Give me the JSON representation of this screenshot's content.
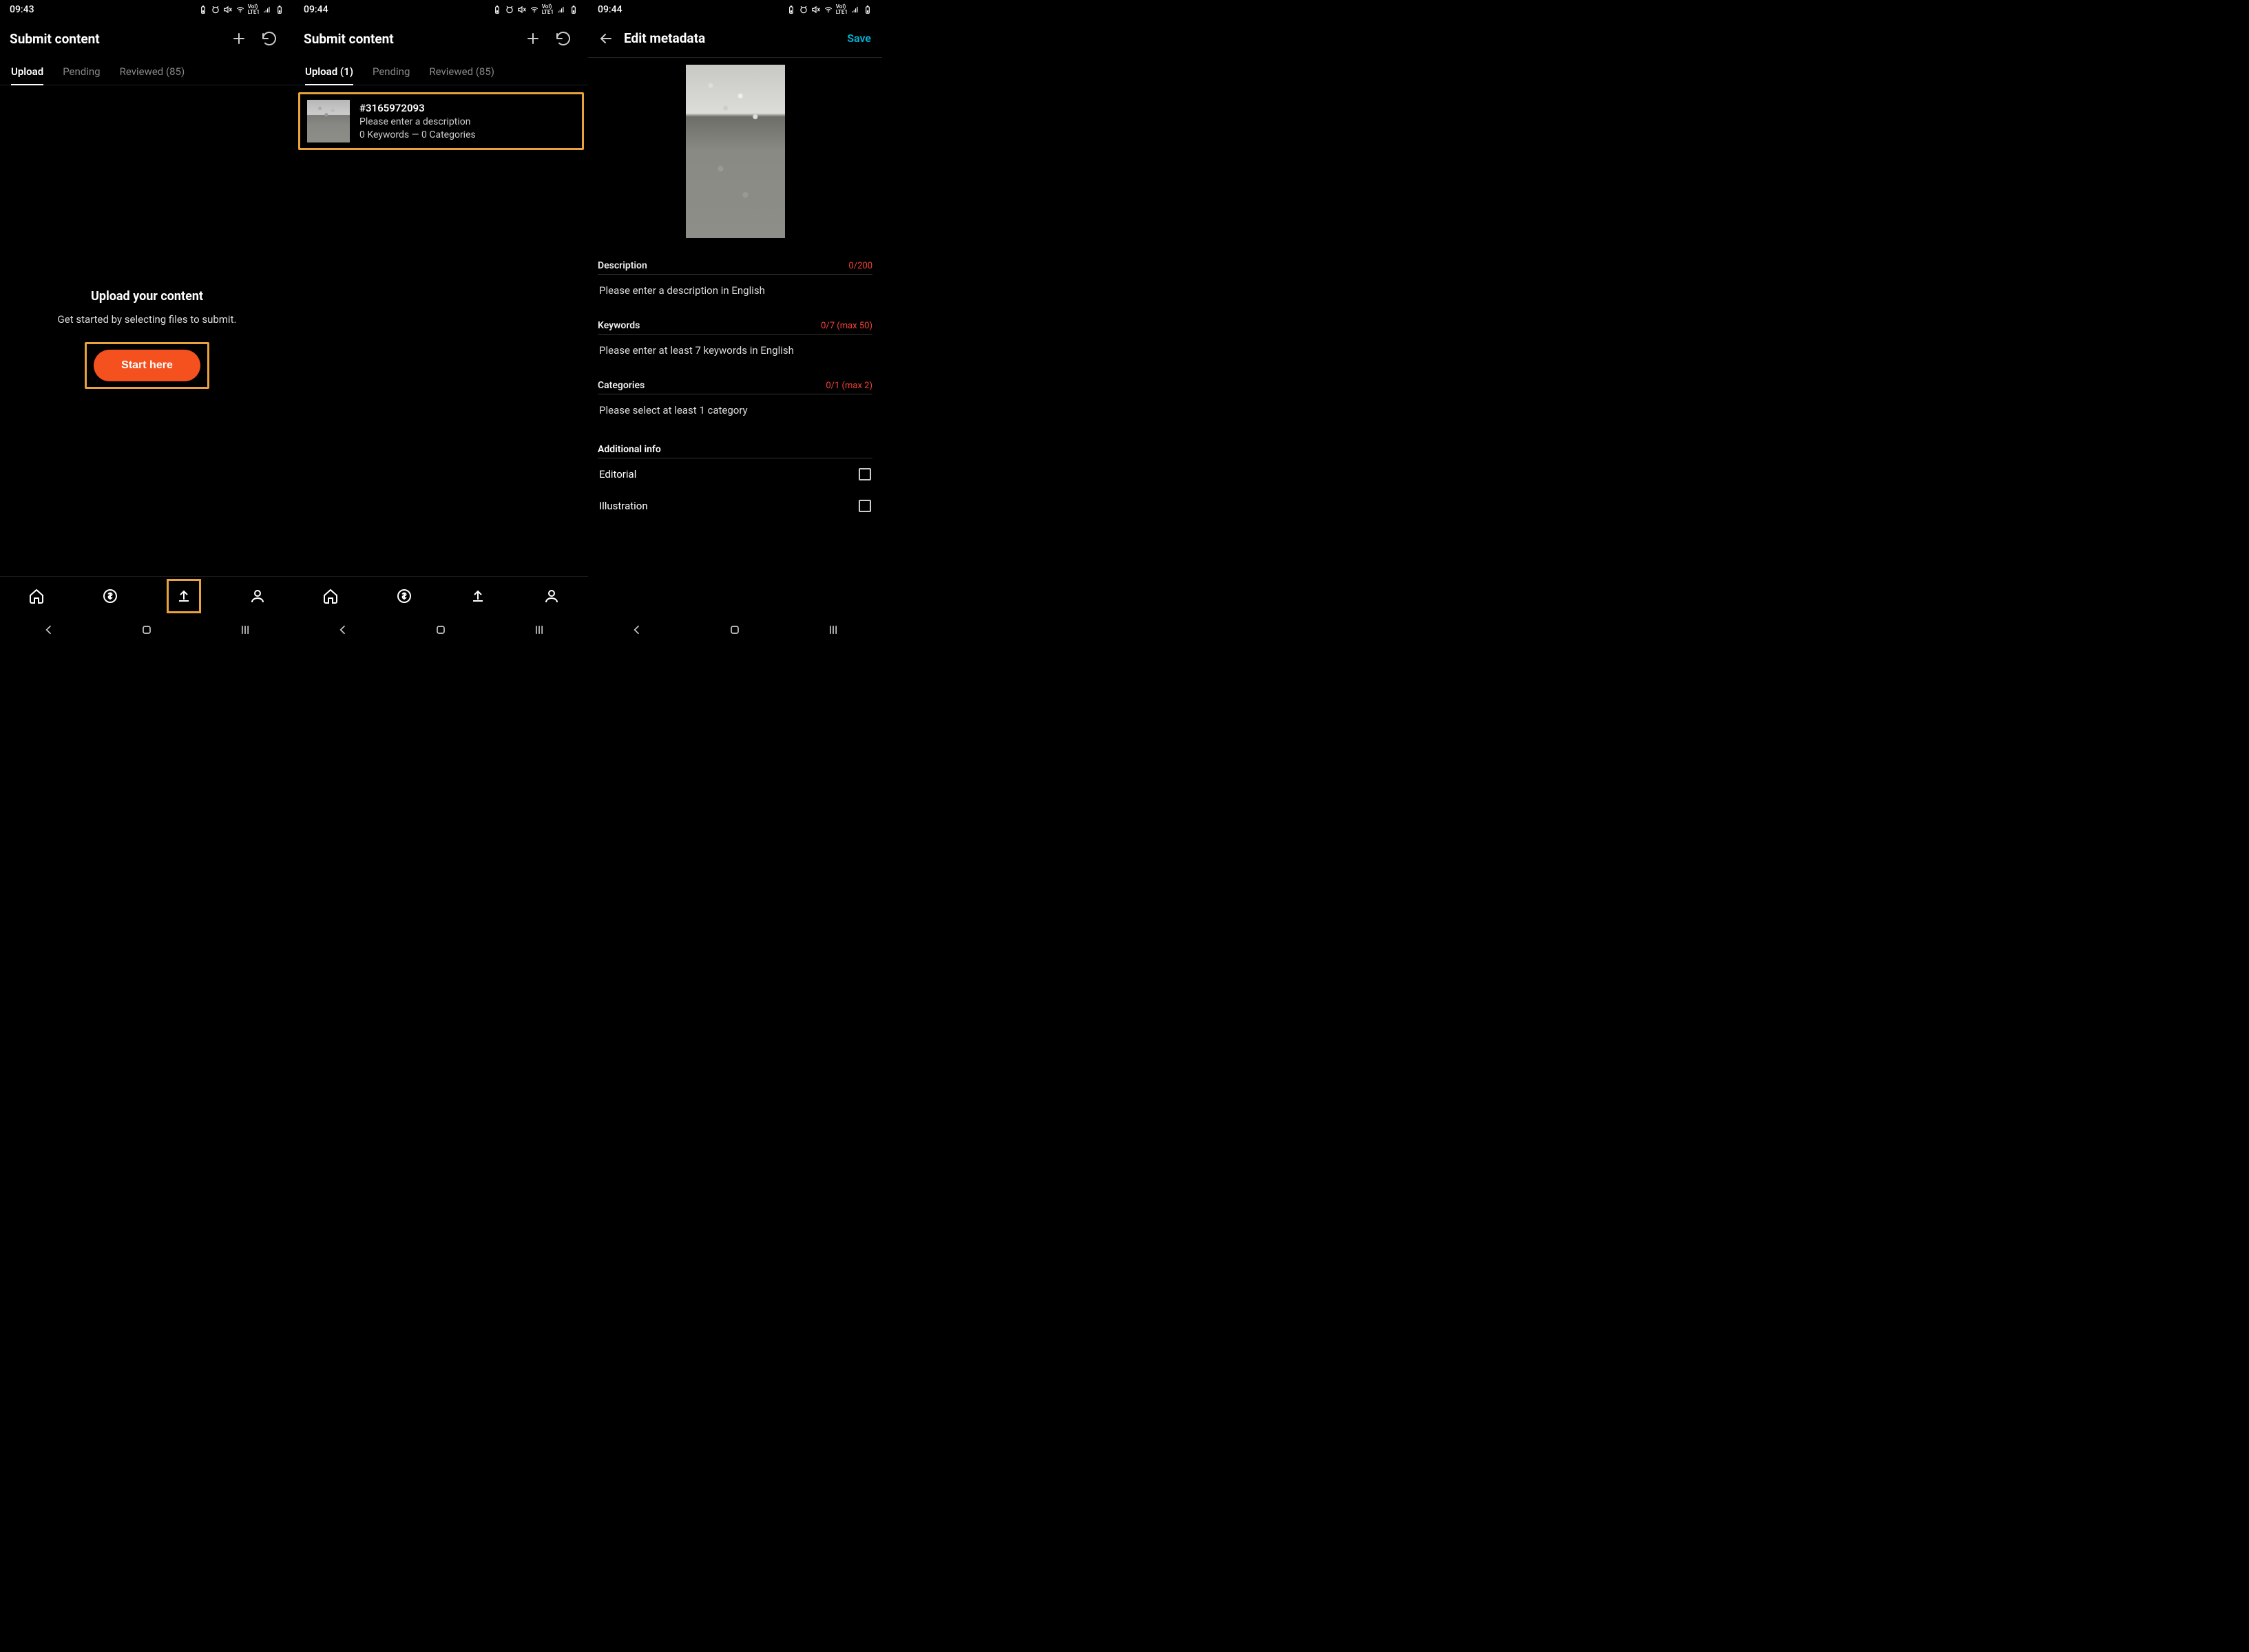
{
  "p1": {
    "time": "09:43",
    "title": "Submit content",
    "tabs": {
      "upload": "Upload",
      "pending": "Pending",
      "reviewed": "Reviewed (85)"
    },
    "center": {
      "title": "Upload your content",
      "sub": "Get started by selecting files to submit.",
      "cta": "Start here"
    }
  },
  "p2": {
    "time": "09:44",
    "title": "Submit content",
    "tabs": {
      "upload": "Upload (1)",
      "pending": "Pending",
      "reviewed": "Reviewed (85)"
    },
    "item": {
      "id": "#3165972093",
      "desc": "Please enter a description",
      "stats": "0 Keywords — 0 Categories"
    }
  },
  "p3": {
    "time": "09:44",
    "title": "Edit metadata",
    "save": "Save",
    "description": {
      "label": "Description",
      "counter": "0/200",
      "placeholder": "Please enter a description in English"
    },
    "keywords": {
      "label": "Keywords",
      "counter": "0/7 (max 50)",
      "placeholder": "Please enter at least 7 keywords in English"
    },
    "categories": {
      "label": "Categories",
      "counter": "0/1 (max 2)",
      "placeholder": "Please select at least 1 category"
    },
    "additional": {
      "label": "Additional info",
      "editorial": "Editorial",
      "illustration": "Illustration"
    }
  }
}
